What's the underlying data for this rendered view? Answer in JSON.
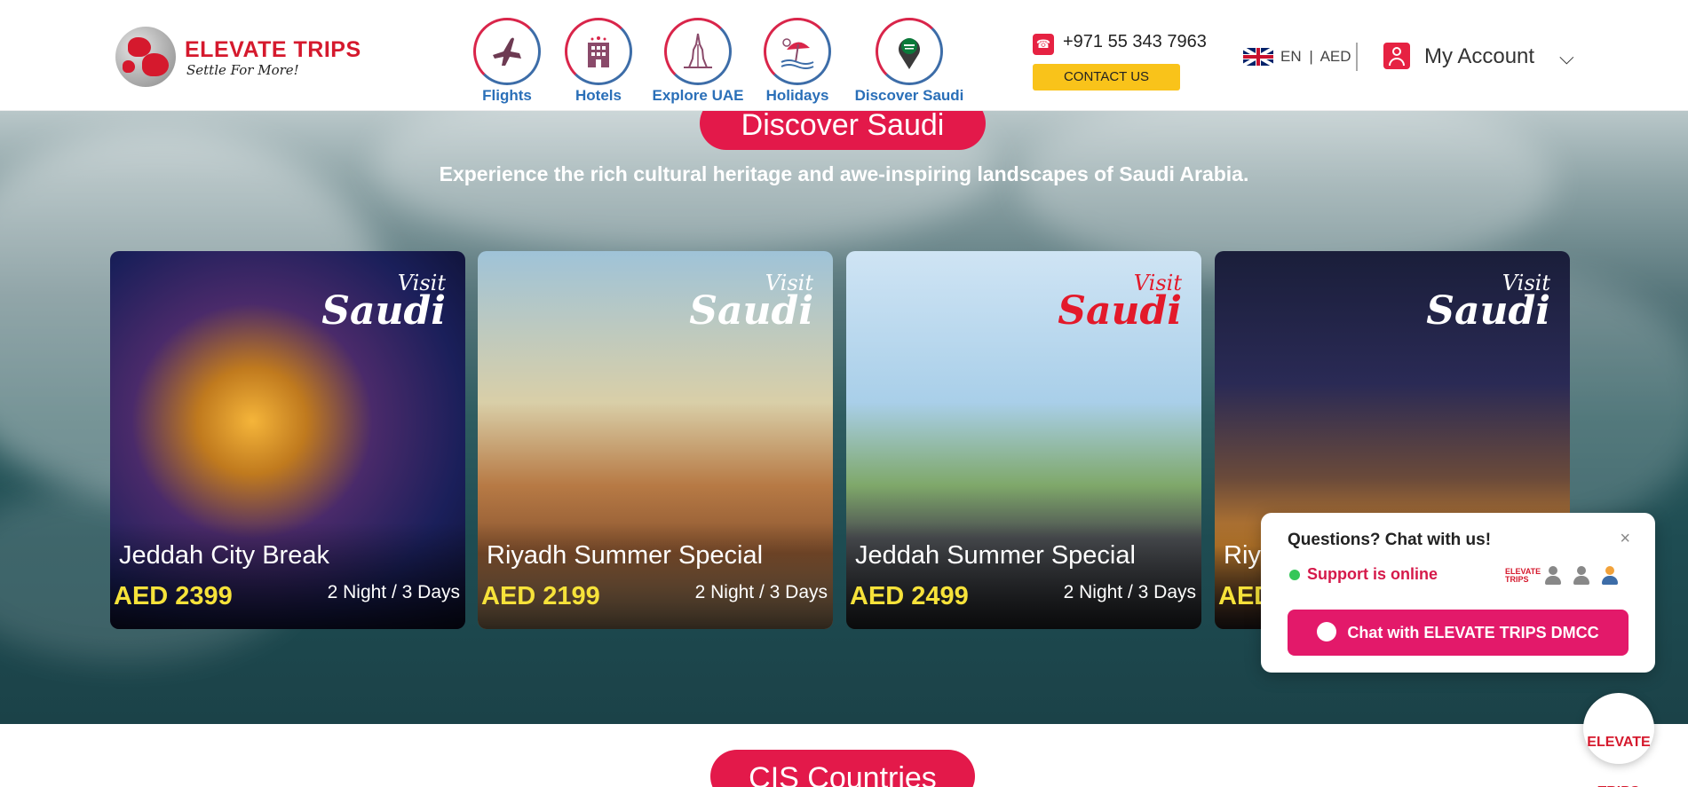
{
  "brand": {
    "name": "ELEVATE TRIPS",
    "tagline": "Settle For More!"
  },
  "nav": [
    {
      "label": "Flights",
      "icon": "airplane-icon"
    },
    {
      "label": "Hotels",
      "icon": "hotel-icon"
    },
    {
      "label": "Explore UAE",
      "icon": "burj-khalifa-icon"
    },
    {
      "label": "Holidays",
      "icon": "beach-umbrella-icon"
    },
    {
      "label": "Discover Saudi",
      "icon": "saudi-flag-pin-icon"
    }
  ],
  "contact": {
    "phone": "+971 55 343 7963",
    "button_label": "CONTACT US"
  },
  "locale": {
    "language": "EN",
    "separator": "|",
    "currency": "AED"
  },
  "account": {
    "label": "My Account"
  },
  "hero": {
    "section_title": "Discover Saudi",
    "subtitle": "Experience the rich cultural heritage and awe-inspiring landscapes of Saudi Arabia."
  },
  "cards": [
    {
      "title": "Jeddah City Break",
      "price": "AED 2399",
      "duration": "2 Night / 3 Days",
      "badge_line1": "Visit",
      "badge_line2": "Saudi",
      "badge_color": "#ffffff"
    },
    {
      "title": "Riyadh Summer Special",
      "price": "AED 2199",
      "duration": "2 Night / 3 Days",
      "badge_line1": "Visit",
      "badge_line2": "Saudi",
      "badge_color": "#ffffff"
    },
    {
      "title": "Jeddah Summer Special",
      "price": "AED 2499",
      "duration": "2 Night / 3 Days",
      "badge_line1": "Visit",
      "badge_line2": "Saudi",
      "badge_color": "#e3192a"
    },
    {
      "title": "Riy",
      "price": "AED",
      "duration": "",
      "badge_line1": "Visit",
      "badge_line2": "Saudi",
      "badge_color": "#ffffff"
    }
  ],
  "chat": {
    "title": "Questions? Chat with us!",
    "close": "×",
    "status": "Support is online",
    "mini_logo": "ELEVATE TRIPS",
    "button_label": "Chat with ELEVATE TRIPS DMCC"
  },
  "fab": {
    "line1": "ELEVATE",
    "line2": "TRIPS"
  },
  "next_section": {
    "title": "CIS Countries"
  },
  "colors": {
    "brand_red": "#d5192d",
    "pill_pink": "#e3194a",
    "nav_blue": "#2a6fb8",
    "contact_yellow": "#f9c31a",
    "price_yellow": "#f6e23a"
  }
}
